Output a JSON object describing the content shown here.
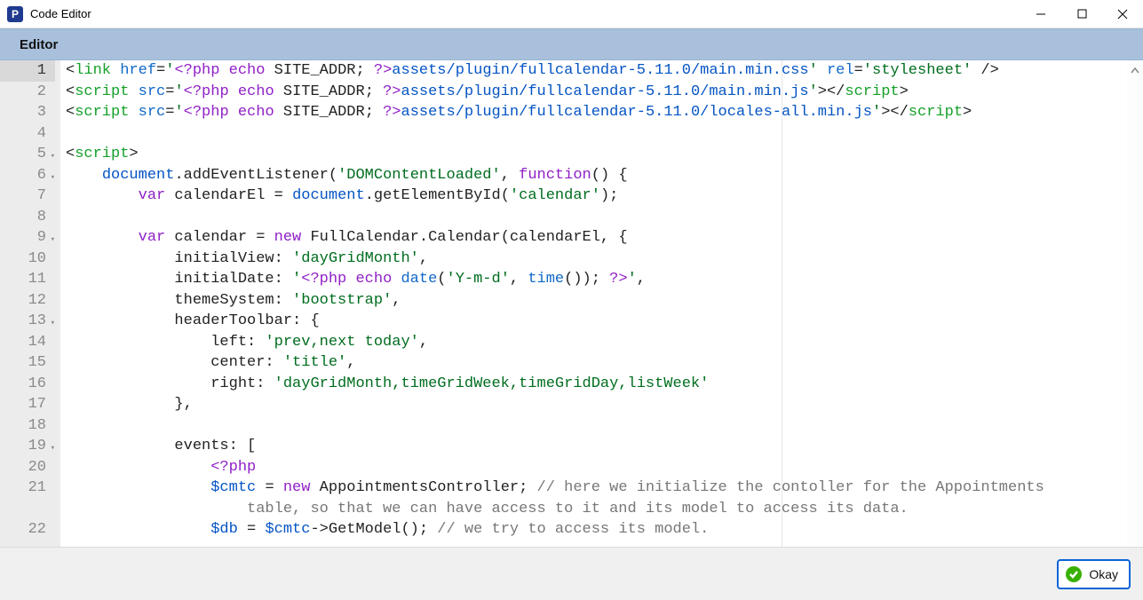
{
  "window": {
    "title": "Code Editor",
    "app_icon_letter": "P"
  },
  "section": {
    "label": "Editor"
  },
  "code": {
    "lines": [
      {
        "num": "1",
        "fold": "",
        "tokens": [
          {
            "c": "tk-default",
            "t": "<"
          },
          {
            "c": "tk-tag",
            "t": "link "
          },
          {
            "c": "tk-attr",
            "t": "href"
          },
          {
            "c": "tk-default",
            "t": "="
          },
          {
            "c": "tk-str",
            "t": "'"
          },
          {
            "c": "tk-php",
            "t": "<?php"
          },
          {
            "c": "tk-default",
            "t": " "
          },
          {
            "c": "tk-kw",
            "t": "echo"
          },
          {
            "c": "tk-default",
            "t": " SITE_ADDR; "
          },
          {
            "c": "tk-php",
            "t": "?>"
          },
          {
            "c": "tk-var",
            "t": "assets/plugin/fullcalendar-5.11.0/main.min.css"
          },
          {
            "c": "tk-str",
            "t": "'"
          },
          {
            "c": "tk-default",
            "t": " "
          },
          {
            "c": "tk-attr",
            "t": "rel"
          },
          {
            "c": "tk-default",
            "t": "="
          },
          {
            "c": "tk-str",
            "t": "'stylesheet'"
          },
          {
            "c": "tk-default",
            "t": " />"
          }
        ]
      },
      {
        "num": "2",
        "fold": "",
        "tokens": [
          {
            "c": "tk-default",
            "t": "<"
          },
          {
            "c": "tk-tag",
            "t": "script "
          },
          {
            "c": "tk-attr",
            "t": "src"
          },
          {
            "c": "tk-default",
            "t": "="
          },
          {
            "c": "tk-str",
            "t": "'"
          },
          {
            "c": "tk-php",
            "t": "<?php"
          },
          {
            "c": "tk-default",
            "t": " "
          },
          {
            "c": "tk-kw",
            "t": "echo"
          },
          {
            "c": "tk-default",
            "t": " SITE_ADDR; "
          },
          {
            "c": "tk-php",
            "t": "?>"
          },
          {
            "c": "tk-var",
            "t": "assets/plugin/fullcalendar-5.11.0/main.min.js"
          },
          {
            "c": "tk-str",
            "t": "'"
          },
          {
            "c": "tk-default",
            "t": ">"
          },
          {
            "c": "tk-default",
            "t": "</"
          },
          {
            "c": "tk-tag",
            "t": "script"
          },
          {
            "c": "tk-default",
            "t": ">"
          }
        ]
      },
      {
        "num": "3",
        "fold": "",
        "tokens": [
          {
            "c": "tk-default",
            "t": "<"
          },
          {
            "c": "tk-tag",
            "t": "script "
          },
          {
            "c": "tk-attr",
            "t": "src"
          },
          {
            "c": "tk-default",
            "t": "="
          },
          {
            "c": "tk-str",
            "t": "'"
          },
          {
            "c": "tk-php",
            "t": "<?php"
          },
          {
            "c": "tk-default",
            "t": " "
          },
          {
            "c": "tk-kw",
            "t": "echo"
          },
          {
            "c": "tk-default",
            "t": " SITE_ADDR; "
          },
          {
            "c": "tk-php",
            "t": "?>"
          },
          {
            "c": "tk-var",
            "t": "assets/plugin/fullcalendar-5.11.0/locales-all.min.js"
          },
          {
            "c": "tk-str",
            "t": "'"
          },
          {
            "c": "tk-default",
            "t": ">"
          },
          {
            "c": "tk-default",
            "t": "</"
          },
          {
            "c": "tk-tag",
            "t": "script"
          },
          {
            "c": "tk-default",
            "t": ">"
          }
        ]
      },
      {
        "num": "4",
        "fold": "",
        "tokens": [
          {
            "c": "tk-default",
            "t": ""
          }
        ]
      },
      {
        "num": "5",
        "fold": "▾",
        "tokens": [
          {
            "c": "tk-default",
            "t": "<"
          },
          {
            "c": "tk-tag",
            "t": "script"
          },
          {
            "c": "tk-default",
            "t": ">"
          }
        ]
      },
      {
        "num": "6",
        "fold": "▾",
        "tokens": [
          {
            "c": "tk-default",
            "t": "    "
          },
          {
            "c": "tk-var",
            "t": "document"
          },
          {
            "c": "tk-default",
            "t": ".addEventListener("
          },
          {
            "c": "tk-str",
            "t": "'DOMContentLoaded'"
          },
          {
            "c": "tk-default",
            "t": ", "
          },
          {
            "c": "tk-kw",
            "t": "function"
          },
          {
            "c": "tk-default",
            "t": "() {"
          }
        ]
      },
      {
        "num": "7",
        "fold": "",
        "tokens": [
          {
            "c": "tk-default",
            "t": "        "
          },
          {
            "c": "tk-kw",
            "t": "var"
          },
          {
            "c": "tk-default",
            "t": " calendarEl = "
          },
          {
            "c": "tk-var",
            "t": "document"
          },
          {
            "c": "tk-default",
            "t": ".getElementById("
          },
          {
            "c": "tk-str",
            "t": "'calendar'"
          },
          {
            "c": "tk-default",
            "t": ");"
          }
        ]
      },
      {
        "num": "8",
        "fold": "",
        "tokens": [
          {
            "c": "tk-default",
            "t": ""
          }
        ]
      },
      {
        "num": "9",
        "fold": "▾",
        "tokens": [
          {
            "c": "tk-default",
            "t": "        "
          },
          {
            "c": "tk-kw",
            "t": "var"
          },
          {
            "c": "tk-default",
            "t": " calendar = "
          },
          {
            "c": "tk-kw",
            "t": "new"
          },
          {
            "c": "tk-default",
            "t": " FullCalendar.Calendar(calendarEl, {"
          }
        ]
      },
      {
        "num": "10",
        "fold": "",
        "tokens": [
          {
            "c": "tk-default",
            "t": "            initialView: "
          },
          {
            "c": "tk-str",
            "t": "'dayGridMonth'"
          },
          {
            "c": "tk-default",
            "t": ","
          }
        ]
      },
      {
        "num": "11",
        "fold": "",
        "tokens": [
          {
            "c": "tk-default",
            "t": "            initialDate: "
          },
          {
            "c": "tk-str",
            "t": "'"
          },
          {
            "c": "tk-php",
            "t": "<?php "
          },
          {
            "c": "tk-kw",
            "t": "echo"
          },
          {
            "c": "tk-default",
            "t": " "
          },
          {
            "c": "tk-funcname",
            "t": "date"
          },
          {
            "c": "tk-default",
            "t": "("
          },
          {
            "c": "tk-str",
            "t": "'Y-m-d'"
          },
          {
            "c": "tk-default",
            "t": ", "
          },
          {
            "c": "tk-funcname",
            "t": "time"
          },
          {
            "c": "tk-default",
            "t": "()); "
          },
          {
            "c": "tk-php",
            "t": "?>"
          },
          {
            "c": "tk-str",
            "t": "'"
          },
          {
            "c": "tk-default",
            "t": ","
          }
        ]
      },
      {
        "num": "12",
        "fold": "",
        "tokens": [
          {
            "c": "tk-default",
            "t": "            themeSystem: "
          },
          {
            "c": "tk-str",
            "t": "'bootstrap'"
          },
          {
            "c": "tk-default",
            "t": ","
          }
        ]
      },
      {
        "num": "13",
        "fold": "▾",
        "tokens": [
          {
            "c": "tk-default",
            "t": "            headerToolbar: {"
          }
        ]
      },
      {
        "num": "14",
        "fold": "",
        "tokens": [
          {
            "c": "tk-default",
            "t": "                left: "
          },
          {
            "c": "tk-str",
            "t": "'prev,next today'"
          },
          {
            "c": "tk-default",
            "t": ","
          }
        ]
      },
      {
        "num": "15",
        "fold": "",
        "tokens": [
          {
            "c": "tk-default",
            "t": "                center: "
          },
          {
            "c": "tk-str",
            "t": "'title'"
          },
          {
            "c": "tk-default",
            "t": ","
          }
        ]
      },
      {
        "num": "16",
        "fold": "",
        "tokens": [
          {
            "c": "tk-default",
            "t": "                right: "
          },
          {
            "c": "tk-str",
            "t": "'dayGridMonth,timeGridWeek,timeGridDay,listWeek'"
          }
        ]
      },
      {
        "num": "17",
        "fold": "",
        "tokens": [
          {
            "c": "tk-default",
            "t": "            },"
          }
        ]
      },
      {
        "num": "18",
        "fold": "",
        "tokens": [
          {
            "c": "tk-default",
            "t": ""
          }
        ]
      },
      {
        "num": "19",
        "fold": "▾",
        "tokens": [
          {
            "c": "tk-default",
            "t": "            events: ["
          }
        ]
      },
      {
        "num": "20",
        "fold": "",
        "tokens": [
          {
            "c": "tk-default",
            "t": "                "
          },
          {
            "c": "tk-php",
            "t": "<?php"
          }
        ]
      },
      {
        "num": "21",
        "fold": "",
        "tokens": [
          {
            "c": "tk-default",
            "t": "                "
          },
          {
            "c": "tk-var",
            "t": "$cmtc"
          },
          {
            "c": "tk-default",
            "t": " = "
          },
          {
            "c": "tk-kw",
            "t": "new"
          },
          {
            "c": "tk-default",
            "t": " AppointmentsController; "
          },
          {
            "c": "tk-comment",
            "t": "// here we initialize the contoller for the Appointments"
          }
        ]
      },
      {
        "num": "",
        "fold": "",
        "tokens": [
          {
            "c": "tk-comment",
            "t": "                    table, so that we can have access to it and its model to access its data."
          }
        ]
      },
      {
        "num": "22",
        "fold": "",
        "tokens": [
          {
            "c": "tk-default",
            "t": "                "
          },
          {
            "c": "tk-var",
            "t": "$db"
          },
          {
            "c": "tk-default",
            "t": " = "
          },
          {
            "c": "tk-var",
            "t": "$cmtc"
          },
          {
            "c": "tk-default",
            "t": "->GetModel(); "
          },
          {
            "c": "tk-comment",
            "t": "// we try to access its model."
          }
        ]
      }
    ]
  },
  "footer": {
    "okay_label": "Okay"
  }
}
